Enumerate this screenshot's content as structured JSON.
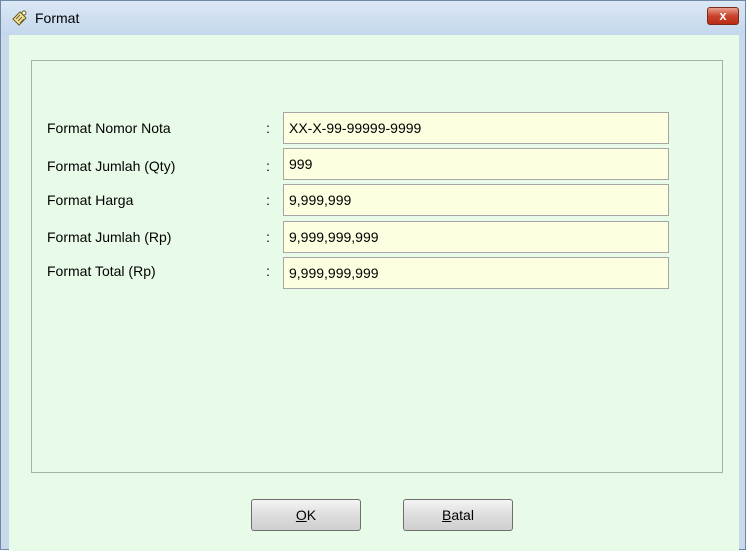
{
  "window": {
    "title": "Format",
    "close_label": "x"
  },
  "icons": {
    "title_icon": "format-app-icon",
    "close": "close-icon"
  },
  "colors": {
    "client_bg": "#e8fbe8",
    "field_bg": "#fefee0",
    "close_bg": "#c9432b"
  },
  "form": {
    "rows": [
      {
        "label": "Format Nomor Nota",
        "colon": ":",
        "value": "XX-X-99-99999-9999"
      },
      {
        "label": "Format Jumlah (Qty)",
        "colon": ":",
        "value": "999"
      },
      {
        "label": "Format Harga",
        "colon": ":",
        "value": "9,999,999"
      },
      {
        "label": "Format Jumlah (Rp)",
        "colon": ":",
        "value": "9,999,999,999"
      },
      {
        "label": "Format Total (Rp)",
        "colon": ":",
        "value": "9,999,999,999"
      }
    ]
  },
  "buttons": {
    "ok": {
      "accel": "O",
      "rest": "K"
    },
    "cancel": {
      "accel": "B",
      "rest": "atal"
    }
  }
}
